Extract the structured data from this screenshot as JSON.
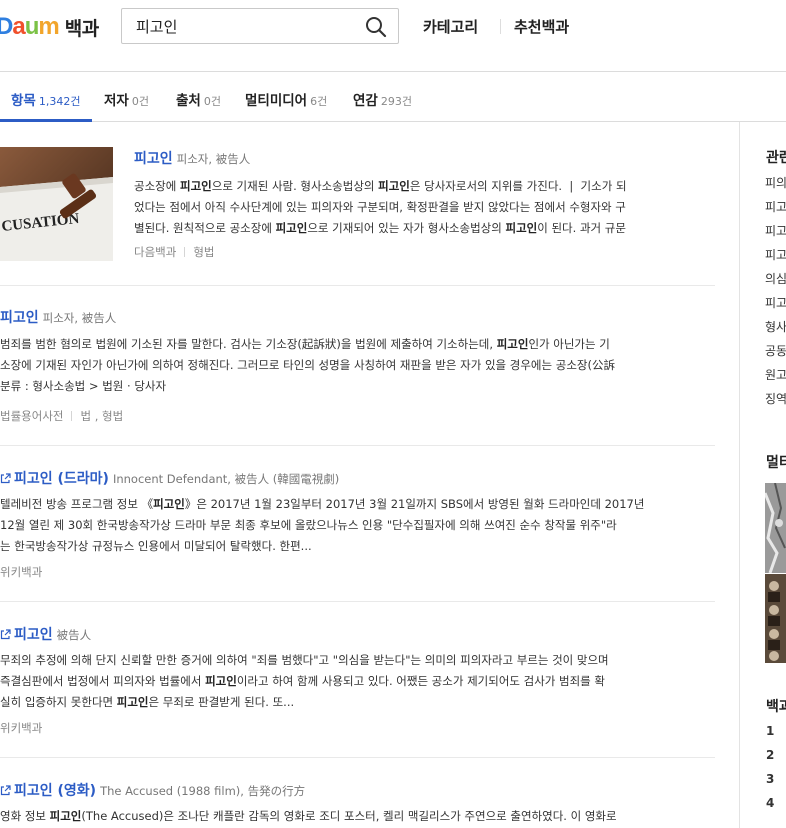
{
  "header": {
    "logo_text": "Daum",
    "service_name": "백과",
    "search_value": "피고인",
    "nav": [
      "카테고리",
      "추천백과"
    ]
  },
  "tabs": [
    {
      "label": "항목",
      "count": "1,342건"
    },
    {
      "label": "저자",
      "count": "0건"
    },
    {
      "label": "출처",
      "count": "0건"
    },
    {
      "label": "멀티미디어",
      "count": "6건"
    },
    {
      "label": "연감",
      "count": "293건"
    }
  ],
  "results": [
    {
      "title": "피고인",
      "subtitle": "피소자, 被告人",
      "thumb_text": "CUSATION",
      "lines": [
        "공소장에 <b>피고인</b>으로 기재된 사람. 형사소송법상의 <b>피고인</b>은 당사자로서의 지위를 가진다. &nbsp;|&nbsp; 기소가 되",
        "었다는 점에서 아직 수사단계에 있는 피의자와 구분되며, 확정판결을 받지 않았다는 점에서 수형자와 구",
        "별된다. 원칙적으로 공소장에 <b>피고인</b>으로 기재되어 있는 자가 형사소송법상의 <b>피고인</b>이 된다. 과거 규문"
      ],
      "sources": [
        "다음백과",
        "형법"
      ]
    },
    {
      "title": "피고인",
      "subtitle": "피소자, 被告人",
      "lines": [
        "범죄를 범한 혐의로 법원에 기소된 자를 말한다. 검사는 기소장(起訴狀)을 법원에 제출하여 기소하는데, <b>피고인</b>인가 아닌가는 기",
        "소장에 기재된 자인가 아닌가에 의하여 정해진다. 그러므로 타인의 성명을 사칭하여 재판을 받은 자가 있을 경우에는 공소장(公訴"
      ],
      "category": "분류 : 형사소송법 > 법원 · 당사자",
      "sources": [
        "법률용어사전",
        "법 , 형법"
      ]
    },
    {
      "title": "피고인 (드라마)",
      "subtitle": "Innocent Defendant, 被告人 (韓國電視劇)",
      "lines": [
        "텔레비전 방송 프로그램 정보 《<b>피고인</b>》은 2017년 1월 23일부터 2017년 3월 21일까지 SBS에서 방영된 월화 드라마인데 2017년",
        "12월 열린 제 30회 한국방송작가상 드라마 부문 최종 후보에 올랐으나뉴스 인용 \"단수집필자에 의해 쓰여진 순수 창작물 위주\"라",
        "는 한국방송작가상 규정뉴스 인용에서 미달되어 탈락했다. 한편..."
      ],
      "sources": [
        "위키백과"
      ]
    },
    {
      "title": "피고인",
      "subtitle": "被告人",
      "lines": [
        "무죄의 추정에 의해 단지 신뢰할 만한 증거에 의하여 \"죄를 범했다\"고 \"의심을 받는다\"는 의미의 피의자라고 부르는 것이 맞으며",
        "즉결심판에서 법정에서 피의자와 법률에서 <b>피고인</b>이라고 하여 함께 사용되고 있다. 어쨌든 공소가 제기되어도 검사가 범죄를 확",
        "실히 입증하지 못한다면 <b>피고인</b>은 무죄로 판결받게 된다. 또..."
      ],
      "sources": [
        "위키백과"
      ]
    },
    {
      "title": "피고인 (영화)",
      "subtitle": "The Accused (1988 film), 告発の行方",
      "lines": [
        "영화 정보 <b>피고인</b>(The Accused)은 조나단 캐플란 감독의 영화로 조디 포스터, 켈리 맥길리스가 주연으로 출연하였다. 이 영화로"
      ],
      "sources": []
    }
  ],
  "sidebar": {
    "related_title": "관련",
    "related_items": [
      "피의",
      "피고",
      "피고",
      "피고",
      "의심",
      "피고",
      "형사",
      "공동",
      "원고",
      "징역"
    ],
    "multimedia_title": "멀티",
    "ranking_title": "백과",
    "ranking_numbers": [
      "1",
      "2",
      "3",
      "4"
    ]
  },
  "colors": {
    "accent": "#2c5cc5",
    "logo": [
      "#f5a623",
      "#4a90e2",
      "#e74c3c",
      "#7ed321"
    ]
  }
}
